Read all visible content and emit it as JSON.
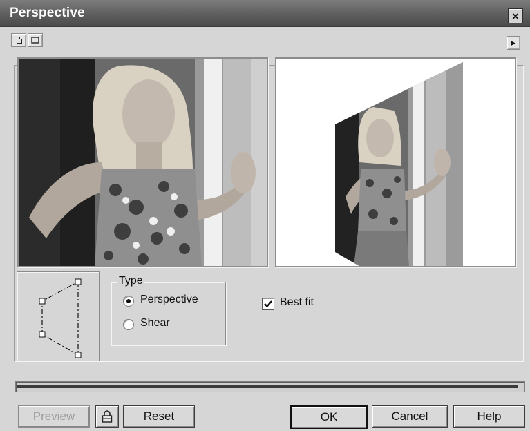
{
  "window": {
    "title": "Perspective",
    "close_glyph": "×"
  },
  "toolbar": {
    "left_buttons": [
      "dual-preview-icon",
      "single-preview-icon"
    ],
    "right_button": "expand-arrow-icon",
    "right_glyph": "▸"
  },
  "previews": {
    "original_label": "original-photo",
    "result_label": "perspective-result-photo"
  },
  "type_group": {
    "title": "Type",
    "options": [
      {
        "label": "Perspective",
        "selected": true
      },
      {
        "label": "Shear",
        "selected": false
      }
    ]
  },
  "best_fit": {
    "label": "Best fit",
    "checked": true
  },
  "progress": {
    "value_percent": 99
  },
  "buttons": {
    "preview": "Preview",
    "lock_icon": "lock-icon",
    "reset": "Reset",
    "ok": "OK",
    "cancel": "Cancel",
    "help": "Help"
  },
  "colors": {
    "titlebar": "#5e5e5e",
    "dialog_bg": "#d6d6d6"
  }
}
